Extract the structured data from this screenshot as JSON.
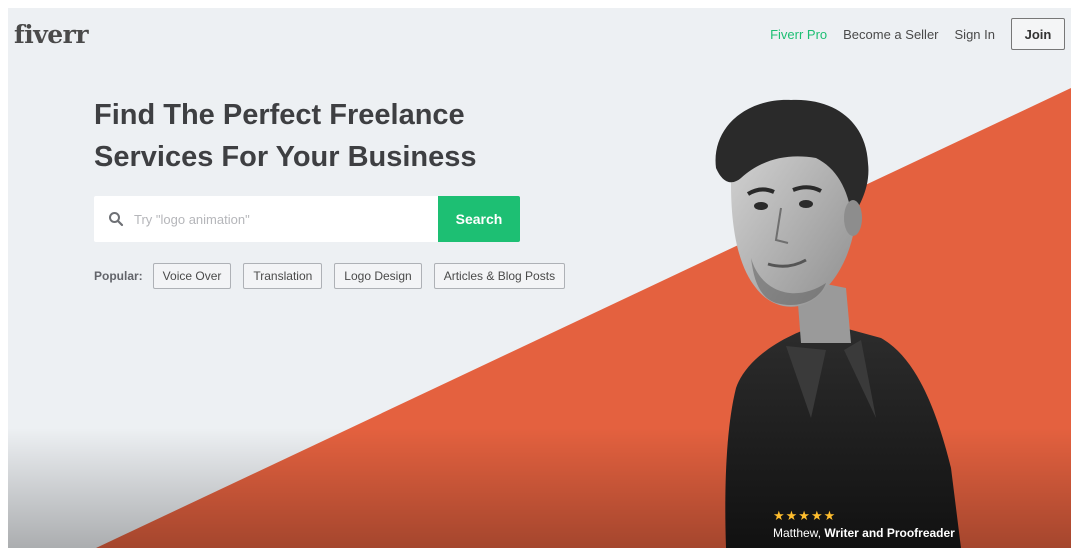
{
  "header": {
    "logo": "fiverr",
    "nav": {
      "pro": "Fiverr Pro",
      "seller": "Become a Seller",
      "signin": "Sign In",
      "join": "Join"
    }
  },
  "hero": {
    "headline_line1": "Find The Perfect Freelance",
    "headline_line2": "Services For Your Business",
    "search": {
      "placeholder": "Try \"logo animation\"",
      "button": "Search",
      "icon": "search-icon"
    },
    "popular": {
      "label": "Popular:",
      "tags": [
        "Voice Over",
        "Translation",
        "Logo Design",
        "Articles & Blog Posts"
      ]
    },
    "featured": {
      "rating_stars": 5,
      "stars": "★★★★★",
      "name": "Matthew,",
      "title": "Writer and Proofreader"
    }
  },
  "colors": {
    "brand_green": "#1dbf73",
    "accent_orange": "#e4613f",
    "hero_background": "#edf0f3",
    "headline_text": "#3e3f42"
  }
}
